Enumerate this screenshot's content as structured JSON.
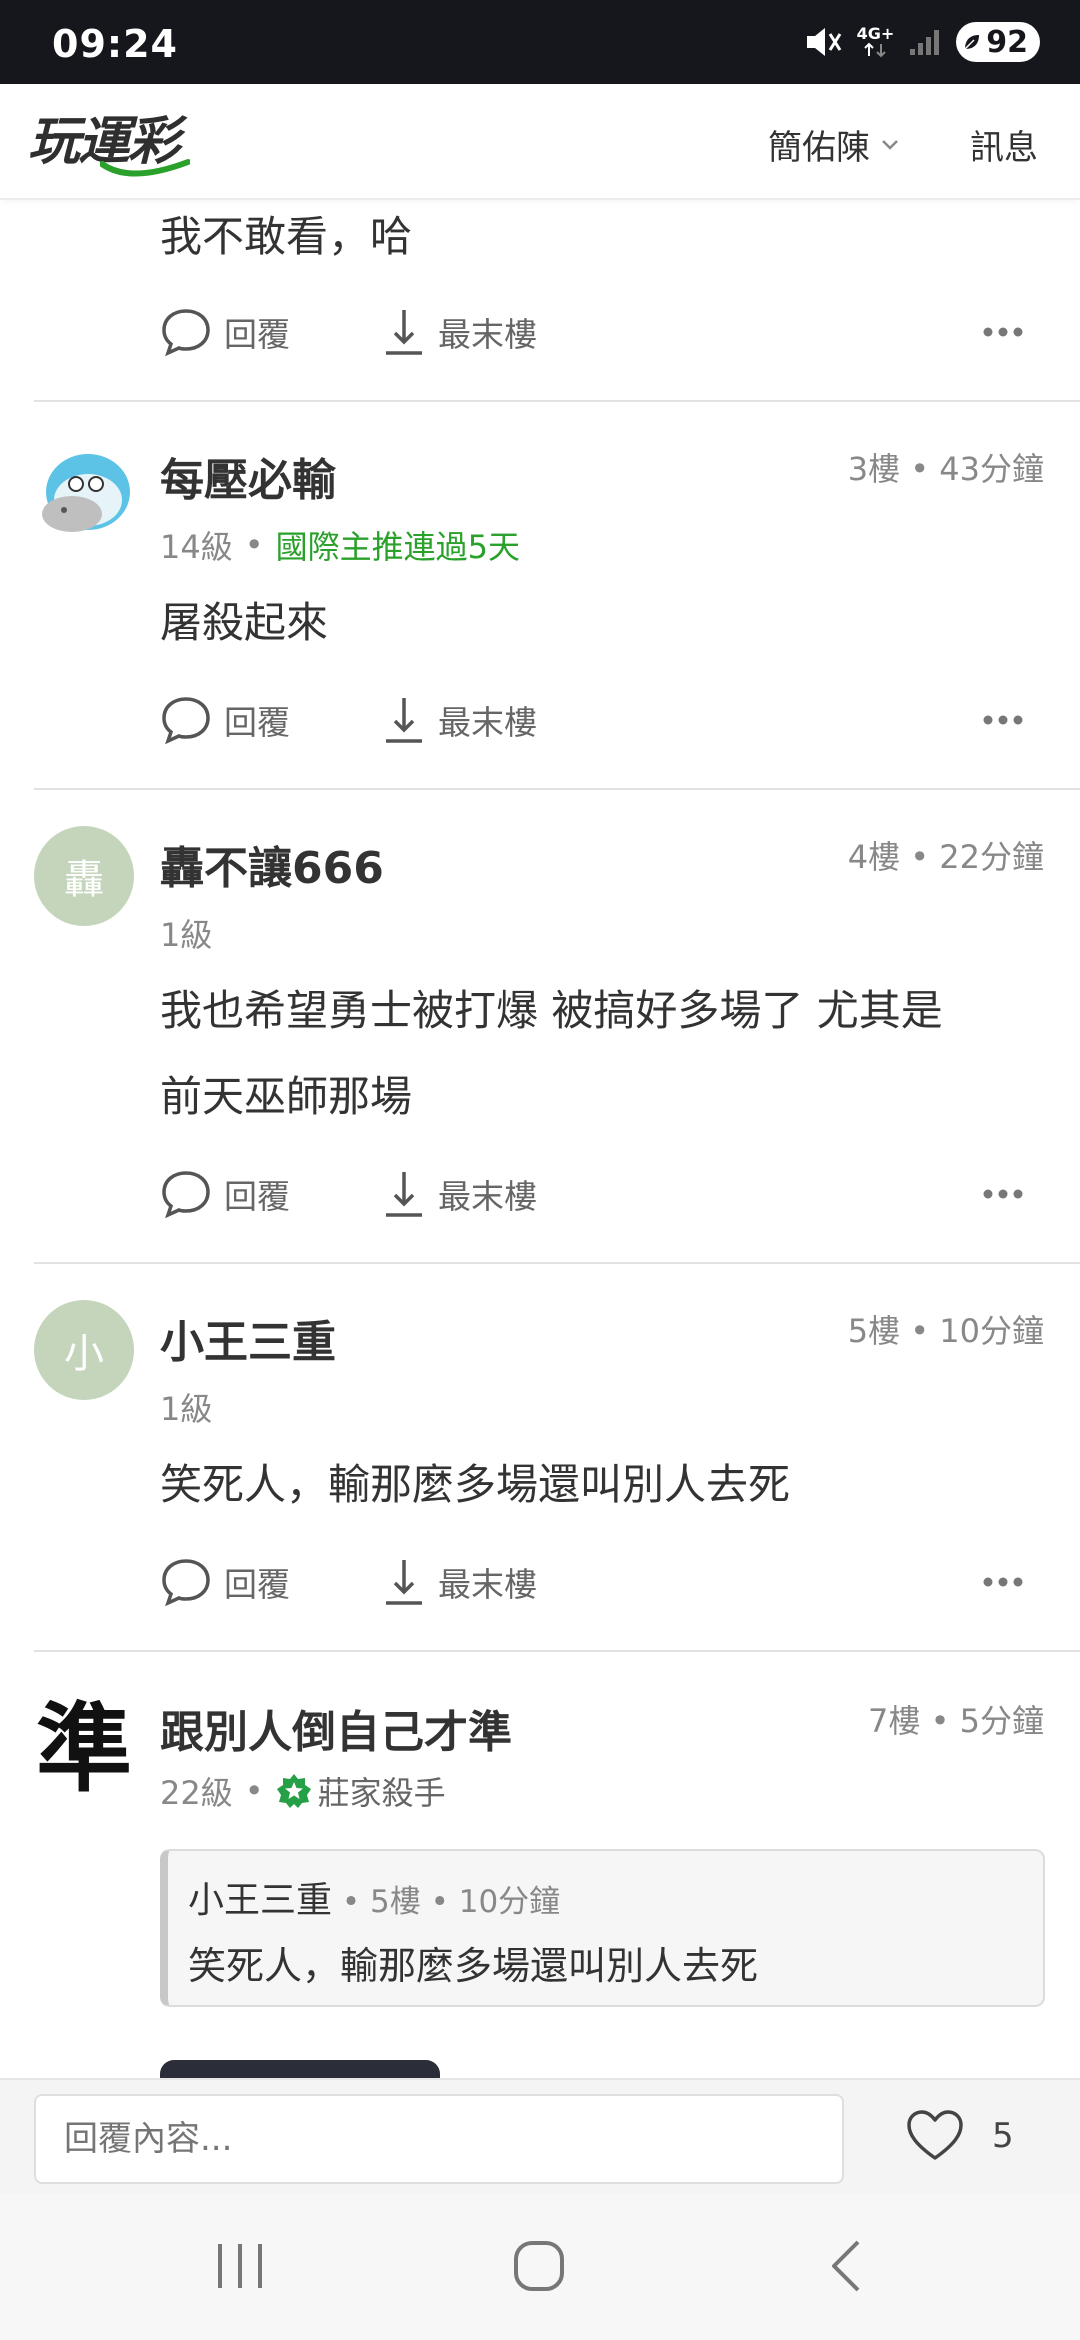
{
  "status_bar": {
    "time": "09:24",
    "network_label": "4G+",
    "battery_level": "92",
    "icons": [
      "mute-vibrate-icon",
      "network-4g-icon",
      "signal-icon",
      "battery-icon"
    ]
  },
  "header": {
    "logo_text": "玩運彩",
    "user_name": "簡佑陳",
    "messages_label": "訊息"
  },
  "actions": {
    "reply_label": "回覆",
    "last_floor_label": "最末樓"
  },
  "comments": [
    {
      "text": "我不敢看，哈"
    },
    {
      "user": "每壓必輸",
      "floor_meta": "3樓 • 43分鐘",
      "level": "14級",
      "badge": "國際主推連過5天",
      "text": "屠殺起來"
    },
    {
      "user": "轟不讓666",
      "avatar_char": "轟",
      "floor_meta": "4樓 • 22分鐘",
      "level": "1級",
      "text_line1": "我也希望勇士被打爆 被搞好多場了 尤其是",
      "text_line2": "前天巫師那場"
    },
    {
      "user": "小王三重",
      "avatar_char": "小",
      "floor_meta": "5樓 • 10分鐘",
      "level": "1級",
      "text": "笑死人，輸那麼多場還叫別人去死"
    },
    {
      "user": "跟別人倒自己才準",
      "avatar_char": "準",
      "floor_meta": "7樓 • 5分鐘",
      "level": "22級",
      "badge": "莊家殺手",
      "quote": {
        "user": "小王三重",
        "meta": " • 5樓 • 10分鐘",
        "text": "笑死人，輸那麼多場還叫別人去死"
      }
    }
  ],
  "reply_bar": {
    "placeholder": "回覆內容...",
    "like_count": "5"
  },
  "colors": {
    "status_bar_bg": "#16171c",
    "accent_green": "#2aa12a",
    "avatar_green": "#c4d5bb",
    "divider": "#e2e2e2"
  }
}
